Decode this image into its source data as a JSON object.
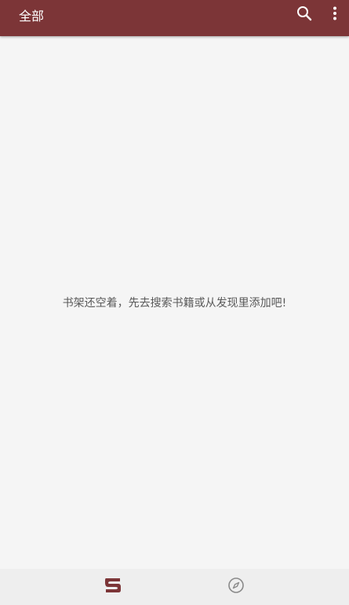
{
  "header": {
    "title": "全部",
    "search_icon": "search-icon",
    "more_icon": "more-vert-icon"
  },
  "main": {
    "empty_message": "书架还空着，先去搜索书籍或从发现里添加吧!"
  },
  "bottom_nav": {
    "items": [
      {
        "icon": "bookshelf-icon",
        "active": true
      },
      {
        "icon": "discover-compass-icon",
        "active": false
      }
    ]
  },
  "colors": {
    "primary": "#7c3537",
    "background": "#f5f5f5",
    "bottom_nav_background": "#eeeeee",
    "text_secondary": "#595959",
    "icon_inactive": "#8a8a8a"
  }
}
